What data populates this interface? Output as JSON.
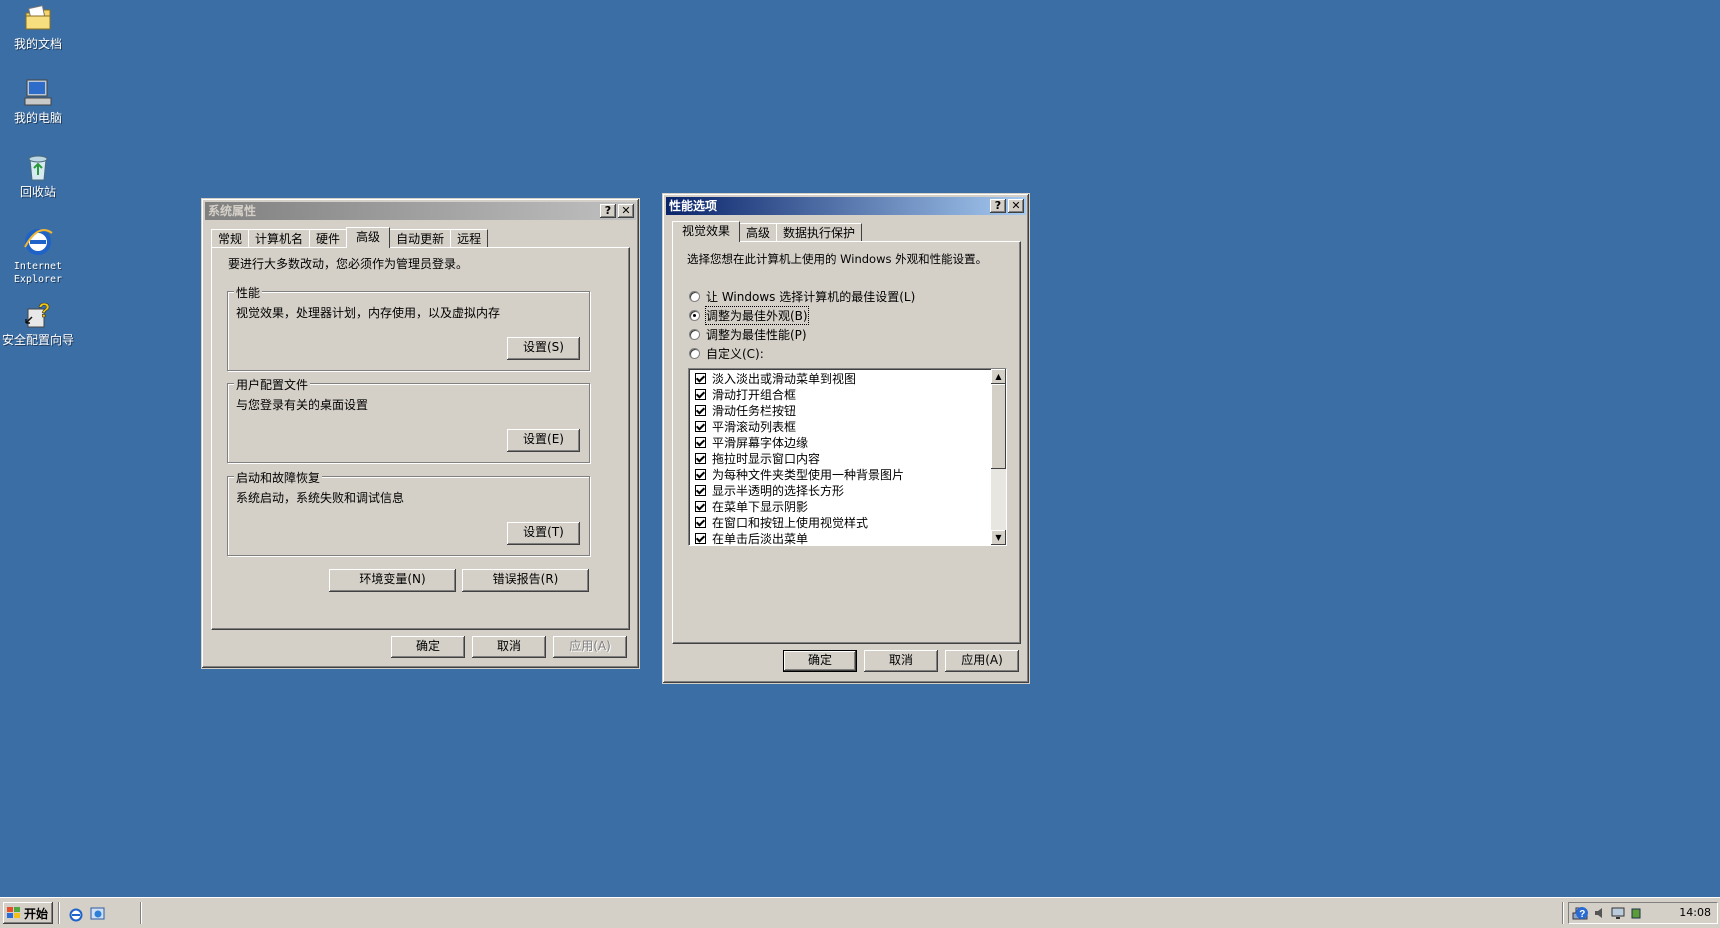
{
  "desktop": {
    "icons": [
      {
        "label": "我的文档"
      },
      {
        "label": "我的电脑"
      },
      {
        "label": "回收站"
      },
      {
        "label": "Internet\nExplorer"
      },
      {
        "label": "安全配置向导"
      }
    ]
  },
  "sysprops": {
    "title": "系统属性",
    "tabs": [
      "常规",
      "计算机名",
      "硬件",
      "高级",
      "自动更新",
      "远程"
    ],
    "selected_tab": "高级",
    "admin_note": "要进行大多数改动，您必须作为管理员登录。",
    "groups": [
      {
        "title": "性能",
        "desc": "视觉效果，处理器计划，内存使用，以及虚拟内存",
        "button": "设置(S)"
      },
      {
        "title": "用户配置文件",
        "desc": "与您登录有关的桌面设置",
        "button": "设置(E)"
      },
      {
        "title": "启动和故障恢复",
        "desc": "系统启动，系统失败和调试信息",
        "button": "设置(T)"
      }
    ],
    "env_button": "环境变量(N)",
    "error_button": "错误报告(R)",
    "ok": "确定",
    "cancel": "取消",
    "apply": "应用(A)"
  },
  "perfopts": {
    "title": "性能选项",
    "tabs": [
      "视觉效果",
      "高级",
      "数据执行保护"
    ],
    "selected_tab": "视觉效果",
    "intro": "选择您想在此计算机上使用的 Windows 外观和性能设置。",
    "radios": [
      {
        "label": "让 Windows 选择计算机的最佳设置(L)",
        "checked": false
      },
      {
        "label": "调整为最佳外观(B)",
        "checked": true
      },
      {
        "label": "调整为最佳性能(P)",
        "checked": false
      },
      {
        "label": "自定义(C):",
        "checked": false
      }
    ],
    "effects": [
      "淡入淡出或滑动菜单到视图",
      "滑动打开组合框",
      "滑动任务栏按钮",
      "平滑滚动列表框",
      "平滑屏幕字体边缘",
      "拖拉时显示窗口内容",
      "为每种文件夹类型使用一种背景图片",
      "显示半透明的选择长方形",
      "在菜单下显示阴影",
      "在窗口和按钮上使用视觉样式",
      "在单击后淡出菜单"
    ],
    "ok": "确定",
    "cancel": "取消",
    "apply": "应用(A)"
  },
  "taskbar": {
    "start": "开始",
    "clock": "14:08"
  },
  "colors": {
    "desktop": "#3a6ea5",
    "face": "#d4d0c8",
    "active_title": "#0a246a"
  }
}
